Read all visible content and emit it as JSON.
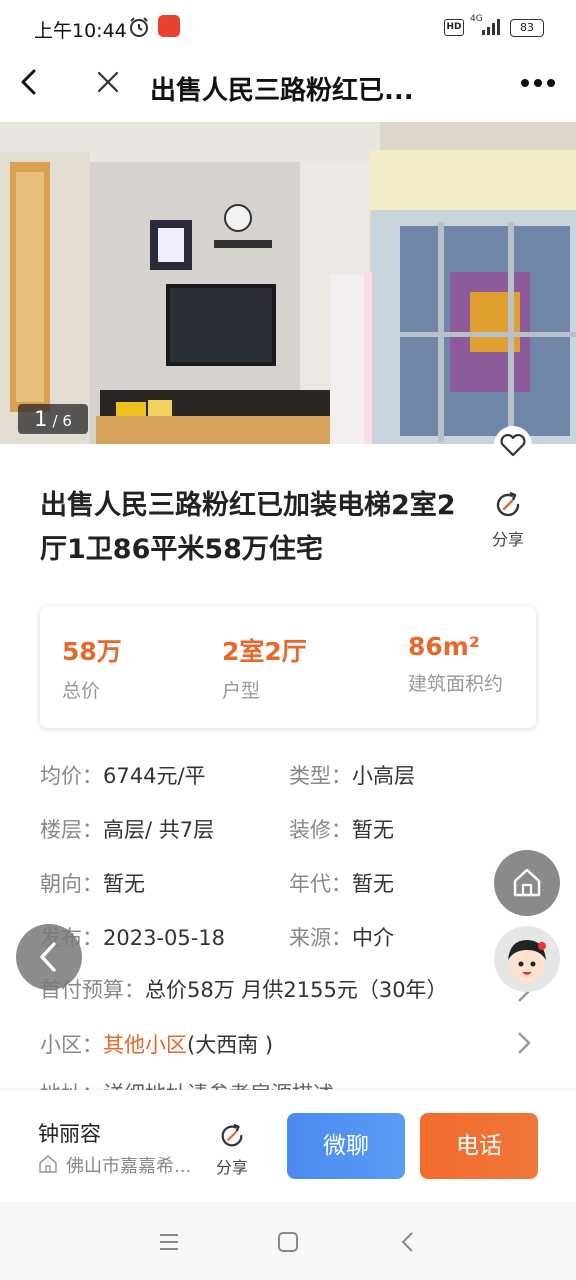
{
  "status_bar": {
    "time": "上午10:44",
    "hd": "HD",
    "network": "4G",
    "battery": "83"
  },
  "nav": {
    "title": "出售人民三路粉红已..."
  },
  "gallery": {
    "current": "1",
    "total": "/ 6"
  },
  "listing": {
    "title": "出售人民三路粉红已加装电梯2室2厅1卫86平米58万住宅",
    "share_label": "分享"
  },
  "summary": [
    {
      "value": "58万",
      "label": "总价"
    },
    {
      "value": "2室2厅",
      "label": "户型"
    },
    {
      "value": "86m²",
      "label": "建筑面积约"
    }
  ],
  "details": {
    "unit_price": {
      "key": "均价：",
      "value": "6744元/平"
    },
    "type": {
      "key": "类型：",
      "value": "小高层"
    },
    "floor": {
      "key": "楼层：",
      "value": "高层/ 共7层"
    },
    "decoration": {
      "key": "装修：",
      "value": "暂无"
    },
    "orientation": {
      "key": "朝向：",
      "value": "暂无"
    },
    "year": {
      "key": "年代：",
      "value": "暂无"
    },
    "published": {
      "key": "发布：",
      "value": "2023-05-18"
    },
    "source": {
      "key": "来源：",
      "value": "中介"
    },
    "budget": {
      "key": "首付预算：",
      "value": "总价58万 月供2155元（30年）"
    },
    "community": {
      "key": "小区：",
      "link": "其他小区",
      "extra": "(大西南 )"
    },
    "address": {
      "key": "地址：",
      "value": "详细地址请参考房源描述"
    }
  },
  "agent": {
    "name": "钟丽容",
    "company": "佛山市嘉嘉希...",
    "share_label": "分享"
  },
  "actions": {
    "chat": "微聊",
    "call": "电话"
  },
  "colors": {
    "accent": "#e8672a",
    "chat": "#4a8af0",
    "call": "#f26b2b"
  }
}
